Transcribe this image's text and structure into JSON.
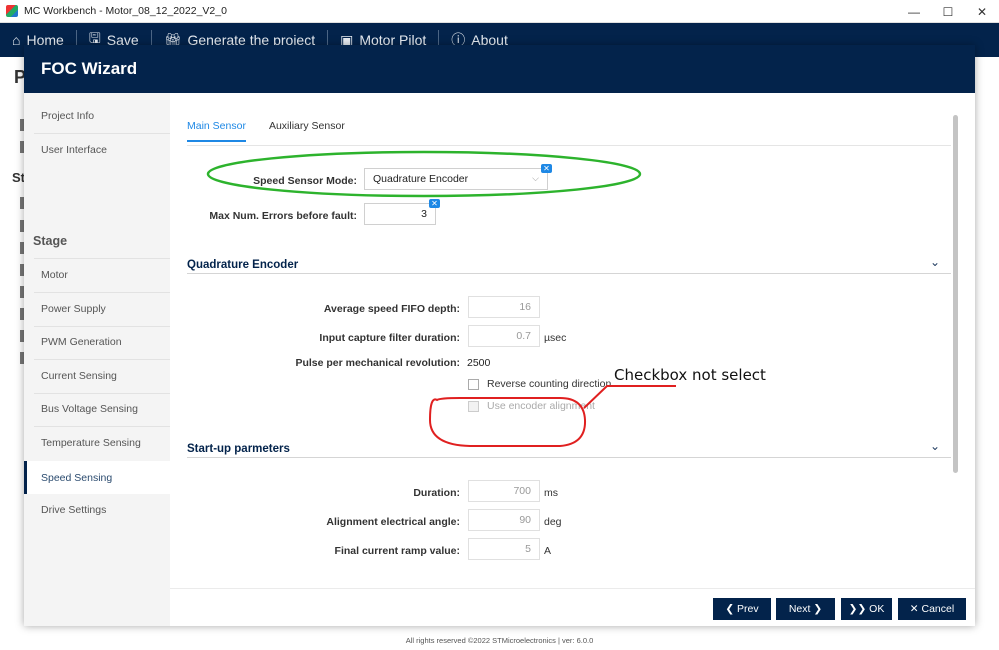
{
  "window": {
    "title": "MC Workbench - Motor_08_12_2022_V2_0",
    "minimize": "—",
    "maximize": "☐",
    "close": "✕"
  },
  "toolbar": {
    "items": [
      {
        "icon": "home-icon",
        "label": "Home"
      },
      {
        "icon": "save-icon",
        "label": "Save"
      },
      {
        "icon": "gift-icon",
        "label": "Generate the project"
      },
      {
        "icon": "motor-pilot-icon",
        "label": "Motor Pilot"
      },
      {
        "icon": "info-icon",
        "label": "About"
      }
    ]
  },
  "background": {
    "letters": [
      "P",
      "St"
    ]
  },
  "footer": "All rights reserved ©2022 STMicroelectronics | ver: 6.0.0",
  "wizard": {
    "title": "FOC Wizard",
    "sidebar": {
      "top_items": [
        "Project Info",
        "User Interface"
      ],
      "heading": "Stage",
      "stage_items": [
        "Motor",
        "Power Supply",
        "PWM Generation",
        "Current Sensing",
        "Bus Voltage Sensing",
        "Temperature Sensing",
        "Speed Sensing",
        "Drive Settings"
      ],
      "active": "Speed Sensing"
    },
    "tabs": [
      "Main Sensor",
      "Auxiliary Sensor"
    ],
    "main": {
      "speed_sensor_mode_label": "Speed Sensor Mode:",
      "speed_sensor_mode_value": "Quadrature Encoder",
      "max_errors_label": "Max Num. Errors before fault:",
      "max_errors_value": "3"
    },
    "quadrature": {
      "title": "Quadrature Encoder",
      "fifo_label": "Average speed FIFO depth:",
      "fifo_value": "16",
      "filter_label": "Input capture filter duration:",
      "filter_value": "0.7",
      "filter_unit": "µsec",
      "ppr_label": "Pulse per mechanical revolution:",
      "ppr_value": "2500",
      "reverse_label": "Reverse counting direction",
      "reverse_checked": false,
      "alignment_label": "Use encoder alignment",
      "alignment_checked": false,
      "alignment_enabled": false
    },
    "startup": {
      "title": "Start-up parmeters",
      "duration_label": "Duration:",
      "duration_value": "700",
      "duration_unit": "ms",
      "angle_label": "Alignment electrical angle:",
      "angle_value": "90",
      "angle_unit": "deg",
      "ramp_label": "Final current ramp value:",
      "ramp_value": "5",
      "ramp_unit": "A"
    },
    "buttons": {
      "prev": "❮ Prev",
      "next": "Next ❯",
      "ok": "❯❯ OK",
      "cancel": "✕ Cancel"
    }
  },
  "annotation": {
    "text": "Checkbox not select",
    "green": "#2db32d",
    "red": "#e02020"
  },
  "colors": {
    "navy": "#03234b",
    "accent": "#1e88e5"
  }
}
